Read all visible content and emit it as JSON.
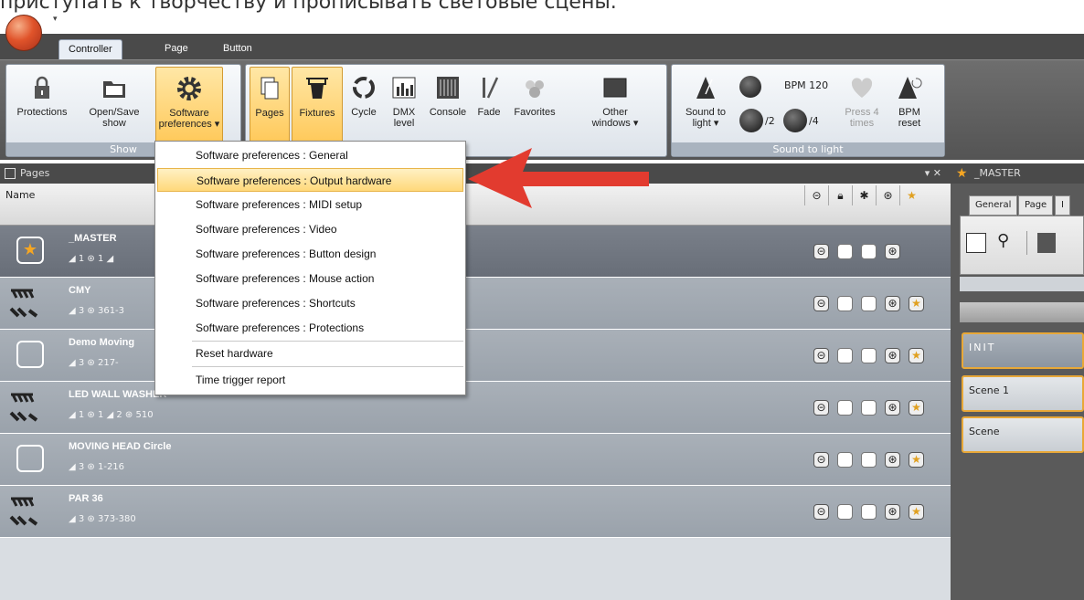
{
  "caption": "приступать к творчеству и прописывать световые сцены.",
  "tabs": [
    "Controller",
    "Page",
    "Button"
  ],
  "groups": {
    "show": "Show",
    "sound": "Sound to light"
  },
  "buttons": {
    "protections": "Protections",
    "open_save_1": "Open/Save",
    "open_save_2": "show",
    "sw_pref_1": "Software",
    "sw_pref_2": "preferences ▾",
    "pages": "Pages",
    "fixtures": "Fixtures",
    "cycle": "Cycle",
    "dmx_1": "DMX",
    "dmx_2": "level",
    "console": "Console",
    "fade": "Fade",
    "favorites": "Favorites",
    "other_1": "Other",
    "other_2": "windows ▾",
    "s2l_1": "Sound to",
    "s2l_2": "light ▾",
    "div2": "/2",
    "div4": "/4",
    "bpm": "BPM 120",
    "press_1": "Press 4",
    "press_2": "times",
    "bpmreset_1": "BPM",
    "bpmreset_2": "reset"
  },
  "menu": {
    "items": [
      "Software preferences : General",
      "Software preferences : Output hardware",
      "Software preferences : MIDI setup",
      "Software preferences : Video",
      "Software preferences : Button design",
      "Software preferences : Mouse action",
      "Software preferences : Shortcuts",
      "Software preferences : Protections",
      "Reset hardware",
      "Time trigger report"
    ],
    "selected_index": 1
  },
  "pages_panel": {
    "title": "Pages",
    "column_name": "Name",
    "rows": [
      {
        "name": "_MASTER",
        "info": "◢ 1  ⊛ 1  ◢"
      },
      {
        "name": "CMY",
        "info": "◢ 3  ⊛ 361-3"
      },
      {
        "name": "Demo Moving",
        "info": "◢ 3  ⊛ 217-"
      },
      {
        "name": "LED WALL WASHER",
        "info": "◢ 1  ⊛ 1  ◢ 2  ⊛ 510"
      },
      {
        "name": "MOVING HEAD Circle",
        "info": "◢ 3  ⊛ 1-216"
      },
      {
        "name": "PAR 36",
        "info": "◢ 3  ⊛ 373-380"
      }
    ]
  },
  "right_panel": {
    "title": "_MASTER",
    "tabs": [
      "General",
      "Page",
      "I"
    ],
    "scenes": [
      "INIT",
      "Scene 1",
      "Scene"
    ]
  },
  "colors": {
    "highlight": "#ffd97a",
    "arrow": "#e23b2f"
  }
}
